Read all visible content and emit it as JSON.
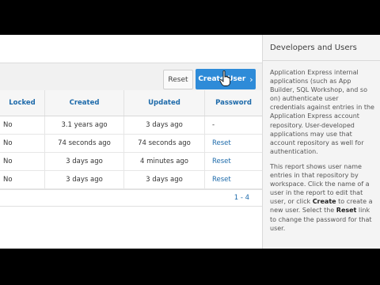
{
  "toolbar": {
    "reset_label": "Reset",
    "create_label": "Create User",
    "create_chevron": "›"
  },
  "table": {
    "headers": [
      "Locked",
      "Created",
      "Updated",
      "Password"
    ],
    "rows": [
      [
        "No",
        "3.1 years ago",
        "3 days ago",
        "-"
      ],
      [
        "No",
        "74 seconds ago",
        "74 seconds ago",
        "Reset"
      ],
      [
        "No",
        "3 days ago",
        "4 minutes ago",
        "Reset"
      ],
      [
        "No",
        "3 days ago",
        "3 days ago",
        "Reset"
      ]
    ]
  },
  "pagination": {
    "range": "1 - 4"
  },
  "side": {
    "title": "Developers and Users",
    "para1": "Application Express internal applications (such as App Builder, SQL Workshop, and so on) authenticate user credentials against entries in the Application Express account repository. User-developed applications may use that account repository as well for authentication.",
    "para2_a": "This report shows user name entries in that repository by workspace. Click the name of a user in the report to edit that user, or click ",
    "para2_create": "Create",
    "para2_b": " to create a new user. Select the ",
    "para2_reset": "Reset",
    "para2_c": " link to change the password for that user."
  },
  "colors": {
    "accent": "#2e8bd8",
    "link": "#1d6aaa"
  }
}
